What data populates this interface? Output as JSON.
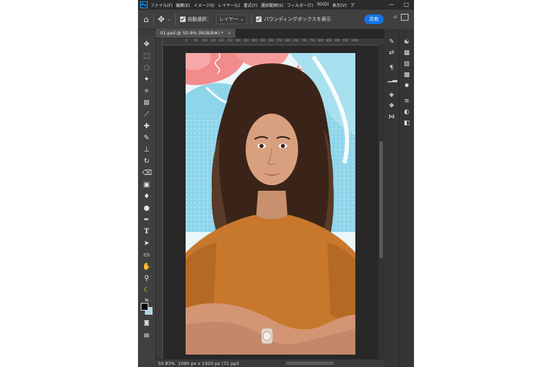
{
  "app": {
    "logo": "Ps"
  },
  "menu": {
    "items": [
      "ファイル(F)",
      "編集(E)",
      "イメージ(I)",
      "レイヤー(L)",
      "書式(Y)",
      "選択範囲(S)",
      "フィルター(T)",
      "3D(D)",
      "表示(V)",
      "プ"
    ]
  },
  "window_controls": {
    "minimize": "—",
    "maximize": "□"
  },
  "options": {
    "auto_select_label": "自動選択：",
    "auto_select_value": "レイヤー",
    "bounding_box_label": "バウンディングボックスを表示",
    "share_label": "共有"
  },
  "document": {
    "tab_title": "01.psd @ 50.8% (RGB/8#) *",
    "tab_close": "×"
  },
  "ruler": {
    "marks": [
      "0",
      "50",
      "100",
      "150",
      "200",
      "250",
      "300",
      "350",
      "400",
      "450",
      "500",
      "550",
      "600",
      "650",
      "700",
      "750",
      "800",
      "850",
      "900",
      "950",
      "1000"
    ]
  },
  "status": {
    "zoom": "50.83%",
    "doc_info": "1080 px x 1920 px (72 ppi)"
  },
  "icons": {
    "home": "home-icon",
    "move": "move-icon",
    "search": "search-icon"
  },
  "colors": {
    "accent": "#1473e6",
    "background_pink": "#f28b8b",
    "background_blue": "#8fd5ea",
    "shirt": "#c8782c"
  }
}
